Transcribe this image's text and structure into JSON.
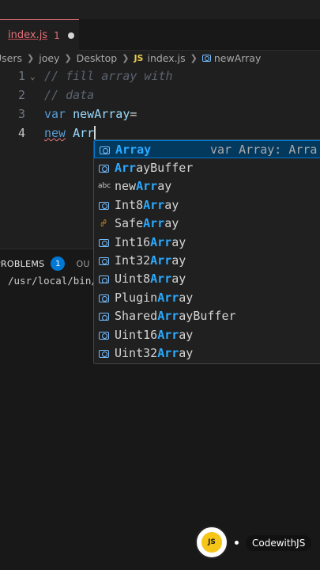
{
  "tab": {
    "name": "index.js",
    "badge": "1"
  },
  "breadcrumb": {
    "items": [
      "Users",
      "joey",
      "Desktop"
    ],
    "js_label": "JS",
    "file": "index.js",
    "symbol": "newArray"
  },
  "editor": {
    "lines": [
      {
        "number": "1",
        "text": "// fill array with"
      },
      {
        "number": "2",
        "text": "// data"
      },
      {
        "number": "3",
        "keyword": "var",
        "name": "newArray",
        "op": "="
      },
      {
        "number": "4",
        "keyword": "new",
        "typed": "Arr"
      }
    ]
  },
  "suggest": {
    "items": [
      {
        "icon": "class-icon",
        "pre": "",
        "match": "Array",
        "post": "",
        "detail": "var Array: Arra"
      },
      {
        "icon": "class-icon",
        "pre": "",
        "match": "Arr",
        "post": "ayBuffer"
      },
      {
        "icon": "abc",
        "pre": "new",
        "match": "Arr",
        "post": "ay"
      },
      {
        "icon": "class-icon",
        "pre": "Int8",
        "match": "Arr",
        "post": "ay"
      },
      {
        "icon": "interface-icon",
        "pre": "Safe",
        "match": "Arr",
        "post": "ay"
      },
      {
        "icon": "class-icon",
        "pre": "Int16",
        "match": "Arr",
        "post": "ay"
      },
      {
        "icon": "class-icon",
        "pre": "Int32",
        "match": "Arr",
        "post": "ay"
      },
      {
        "icon": "class-icon",
        "pre": "Uint8",
        "match": "Arr",
        "post": "ay"
      },
      {
        "icon": "class-icon",
        "pre": "Plugin",
        "match": "Arr",
        "post": "ay"
      },
      {
        "icon": "class-icon",
        "pre": "Shared",
        "match": "Arr",
        "post": "ayBuffer"
      },
      {
        "icon": "class-icon",
        "pre": "Uint16",
        "match": "Arr",
        "post": "ay"
      },
      {
        "icon": "class-icon",
        "pre": "Uint32",
        "match": "Arr",
        "post": "ay"
      }
    ]
  },
  "panel": {
    "problems_label": "PROBLEMS",
    "problems_count": "1",
    "output_label": "OU",
    "text": "/usr/local/bin/r"
  },
  "brand": {
    "logo_text": "JS",
    "name": "CodewithJS"
  },
  "colors": {
    "accent": "#0078d4",
    "keyword": "#569cd6",
    "match": "#2aaaff",
    "error": "#e2717a"
  }
}
